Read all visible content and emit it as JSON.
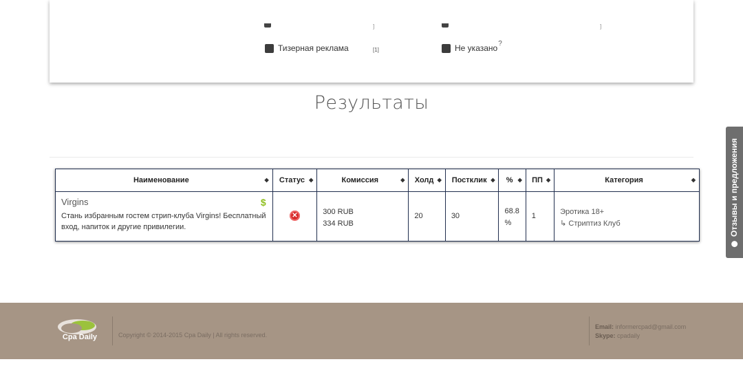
{
  "filters": {
    "items": [
      {
        "label": "Тизерная реклама",
        "count": "[1]"
      },
      {
        "label": "Не указано",
        "help": "?"
      }
    ]
  },
  "results": {
    "title": "Результаты",
    "columns": [
      "Наименование",
      "Статус",
      "Комиссия",
      "Холд",
      "Постклик",
      "%",
      "ПП",
      "Категория"
    ],
    "rows": [
      {
        "name": "Virgins",
        "description": "Стань избранным гостем стрип-клуба Virgins! Бесплатный вход, напиток и другие привилегии.",
        "commission": [
          "300 RUB",
          "334 RUB"
        ],
        "hold": "20",
        "postclick": "30",
        "percent": "68.8 %",
        "pp": "1",
        "category": "Эротика 18+",
        "subcategory": "↳ Стриптиз Клуб"
      }
    ]
  },
  "feedback": {
    "label": "Отзывы и предложения"
  },
  "footer": {
    "logo_text": "Cpa Daily",
    "copyright": "Copyright © 2014-2015 Cpa Daily | All rights reserved.",
    "email_label": "Email:",
    "email": "informercpad@gmail.com",
    "skype_label": "Skype:",
    "skype": "cpadaily"
  },
  "colors": {
    "footer_bg": "#a69585",
    "table_border": "#1f2d4d",
    "status_red": "#d62b2b",
    "dollar_green": "#8fbf1f"
  }
}
